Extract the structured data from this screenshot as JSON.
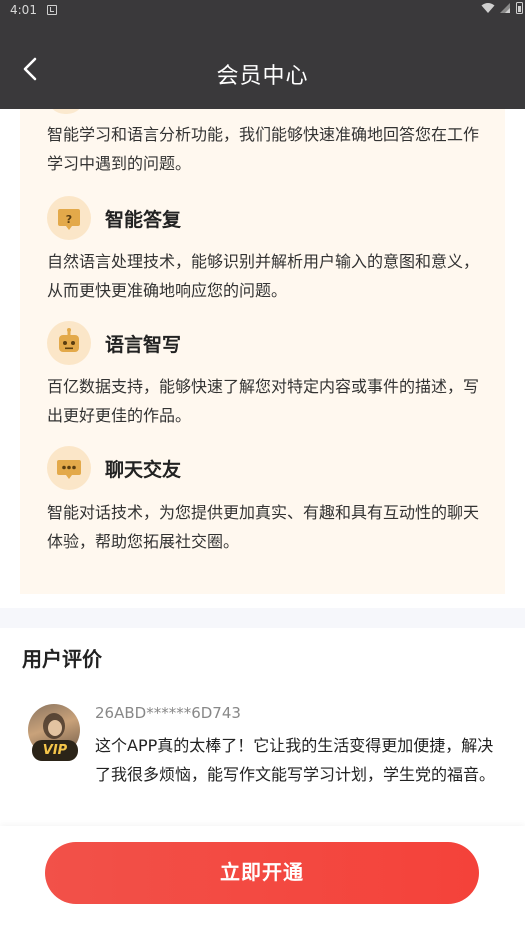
{
  "status_bar": {
    "time": "4:01"
  },
  "header": {
    "title": "会员中心"
  },
  "features": {
    "intro_text": "智能学习和语言分析功能，我们能够快速准确地回答您在工作学习中遇到的问题。",
    "items": [
      {
        "title": "智能答复",
        "icon": "question-bubble-icon",
        "desc": "自然语言处理技术，能够识别并解析用户输入的意图和意义，从而更快更准确地响应您的问题。"
      },
      {
        "title": "语言智写",
        "icon": "robot-icon",
        "desc": "百亿数据支持，能够快速了解您对特定内容或事件的描述，写出更好更佳的作品。"
      },
      {
        "title": "聊天交友",
        "icon": "chat-bubble-icon",
        "desc": "智能对话技术，为您提供更加真实、有趣和具有互动性的聊天体验，帮助您拓展社交圈。"
      }
    ]
  },
  "reviews": {
    "title": "用户评价",
    "items": [
      {
        "user": "26ABD******6D743",
        "badge": "VIP",
        "text": "这个APP真的太棒了！它让我的生活变得更加便捷，解决了我很多烦恼，能写作文能写学习计划，学生党的福音。"
      }
    ]
  },
  "cta": {
    "label": "立即开通"
  },
  "colors": {
    "header_bg": "#3a393b",
    "accent": "#f4473f",
    "feature_bg": "#fff8ef",
    "icon_bg": "#fbe6c8",
    "icon_fg": "#e3a94a"
  }
}
